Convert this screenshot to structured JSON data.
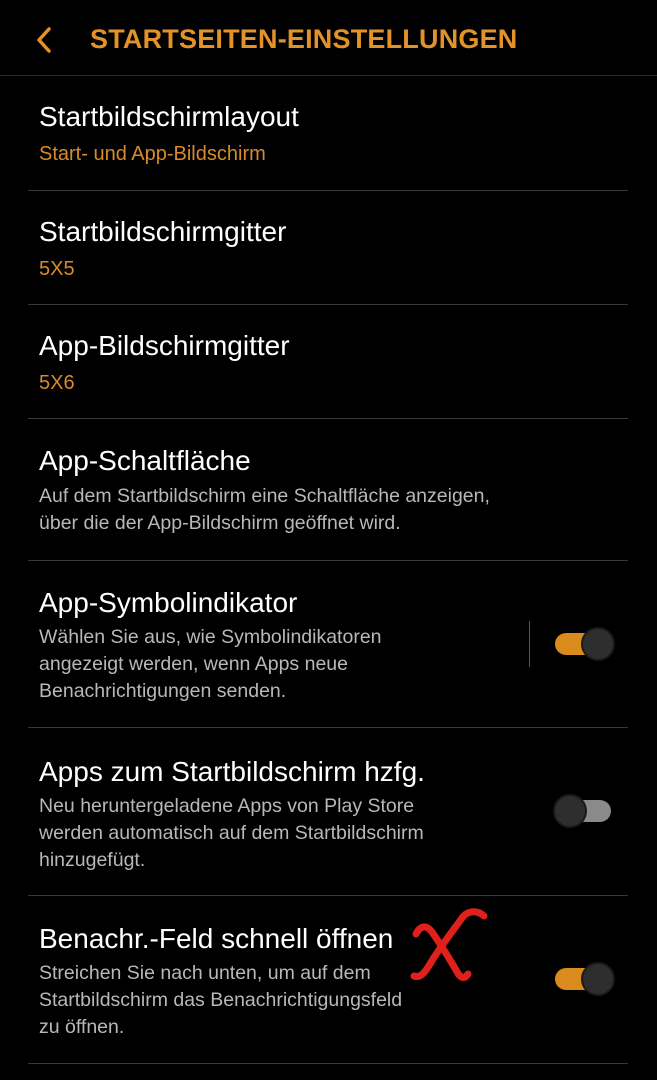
{
  "header": {
    "title": "STARTSEITEN-EINSTELLUNGEN",
    "back_icon": "chevron-left-icon",
    "accent_color": "#e3922a"
  },
  "settings": [
    {
      "title": "Startbildschirmlayout",
      "value": "Start- und App-Bildschirm"
    },
    {
      "title": "Startbildschirmgitter",
      "value": "5X5"
    },
    {
      "title": "App-Bildschirmgitter",
      "value": "5X6"
    },
    {
      "title": "App-Schaltfläche",
      "desc": [
        "Auf dem Startbildschirm eine Schaltfläche anzeigen,",
        "über die der App-Bildschirm geöffnet wird."
      ]
    },
    {
      "title": "App-Symbolindikator",
      "desc": [
        "Wählen Sie aus, wie Symbolindikatoren",
        "angezeigt werden, wenn Apps neue",
        "Benachrichtigungen senden."
      ],
      "toggle": "on"
    },
    {
      "title": "Apps zum Startbildschirm hzfg.",
      "desc": [
        "Neu heruntergeladene Apps von Play Store",
        "werden automatisch auf dem Startbildschirm",
        "hinzugefügt."
      ],
      "toggle": "off"
    },
    {
      "title": "Benachr.-Feld schnell öffnen",
      "desc": [
        "Streichen Sie nach unten, um auf dem",
        "Startbildschirm das Benachrichtigungsfeld",
        "zu öffnen."
      ],
      "toggle": "on"
    }
  ],
  "colors": {
    "toggle_on": "#d98c1d",
    "toggle_off": "#8a8a8a",
    "annotation_mark": "#e0201c"
  }
}
